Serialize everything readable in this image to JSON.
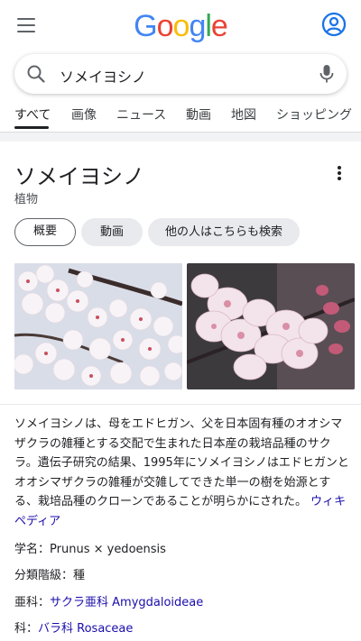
{
  "header": {
    "logo_letters": [
      "G",
      "o",
      "o",
      "g",
      "l",
      "e"
    ],
    "logo_colors": [
      "#4285F4",
      "#EA4335",
      "#FBBC05",
      "#4285F4",
      "#34A853",
      "#EA4335"
    ]
  },
  "search": {
    "query": "ソメイヨシノ"
  },
  "tabs": [
    {
      "label": "すべて"
    },
    {
      "label": "画像"
    },
    {
      "label": "ニュース"
    },
    {
      "label": "動画"
    },
    {
      "label": "地図"
    },
    {
      "label": "ショッピング"
    }
  ],
  "panel": {
    "title": "ソメイヨシノ",
    "subtitle": "植物",
    "chips": [
      {
        "label": "概要"
      },
      {
        "label": "動画"
      },
      {
        "label": "他の人はこちらも検索"
      }
    ],
    "description": "ソメイヨシノは、母をエドヒガン、父を日本固有種のオオシマザクラの雑種とする交配で生まれた日本産の栽培品種のサクラ。遺伝子研究の結果、1995年にソメイヨシノはエドヒガンとオオシマザクラの雑種が交雑してできた単一の樹を始源とする、栽培品種のクローンであることが明らかにされた。",
    "source_link": "ウィキペディア",
    "facts": [
      {
        "label": "学名：",
        "value": "Prunus × yedoensis"
      },
      {
        "label": "分類階級：",
        "value": "種"
      },
      {
        "label": "亜科：",
        "value": "サクラ亜科 Amygdaloideae"
      },
      {
        "label": "科：",
        "value": "バラ科 Rosaceae"
      }
    ]
  },
  "colors": {
    "link": "#1a0dab",
    "accent_blue": "#1a73e8"
  }
}
